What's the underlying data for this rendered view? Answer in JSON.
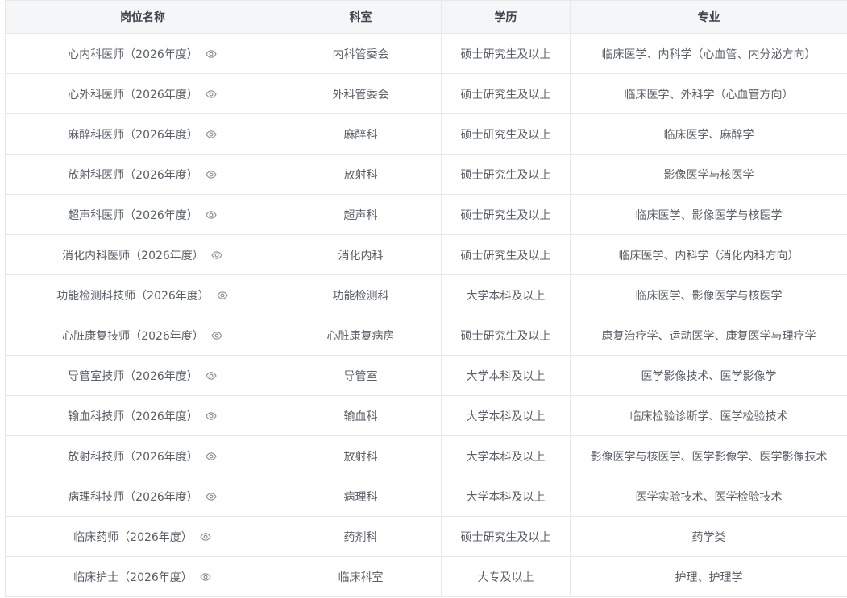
{
  "table": {
    "headers": [
      "岗位名称",
      "科室",
      "学历",
      "专业"
    ],
    "rows": [
      {
        "position": "心内科医师（2026年度）",
        "dept": "内科管委会",
        "edu": "硕士研究生及以上",
        "major": "临床医学、内科学（心血管、内分泌方向）"
      },
      {
        "position": "心外科医师（2026年度）",
        "dept": "外科管委会",
        "edu": "硕士研究生及以上",
        "major": "临床医学、外科学（心血管方向）"
      },
      {
        "position": "麻醉科医师（2026年度）",
        "dept": "麻醉科",
        "edu": "硕士研究生及以上",
        "major": "临床医学、麻醉学"
      },
      {
        "position": "放射科医师（2026年度）",
        "dept": "放射科",
        "edu": "硕士研究生及以上",
        "major": "影像医学与核医学"
      },
      {
        "position": "超声科医师（2026年度）",
        "dept": "超声科",
        "edu": "硕士研究生及以上",
        "major": "临床医学、影像医学与核医学"
      },
      {
        "position": "消化内科医师（2026年度）",
        "dept": "消化内科",
        "edu": "硕士研究生及以上",
        "major": "临床医学、内科学（消化内科方向）"
      },
      {
        "position": "功能检测科技师（2026年度）",
        "dept": "功能检测科",
        "edu": "大学本科及以上",
        "major": "临床医学、影像医学与核医学"
      },
      {
        "position": "心脏康复技师（2026年度）",
        "dept": "心脏康复病房",
        "edu": "硕士研究生及以上",
        "major": "康复治疗学、运动医学、康复医学与理疗学"
      },
      {
        "position": "导管室技师（2026年度）",
        "dept": "导管室",
        "edu": "大学本科及以上",
        "major": "医学影像技术、医学影像学"
      },
      {
        "position": "输血科技师（2026年度）",
        "dept": "输血科",
        "edu": "大学本科及以上",
        "major": "临床检验诊断学、医学检验技术"
      },
      {
        "position": "放射科技师（2026年度）",
        "dept": "放射科",
        "edu": "大学本科及以上",
        "major": "影像医学与核医学、医学影像学、医学影像技术"
      },
      {
        "position": "病理科技师（2026年度）",
        "dept": "病理科",
        "edu": "大学本科及以上",
        "major": "医学实验技术、医学检验技术"
      },
      {
        "position": "临床药师（2026年度）",
        "dept": "药剂科",
        "edu": "硕士研究生及以上",
        "major": "药学类"
      },
      {
        "position": "临床护士（2026年度）",
        "dept": "临床科室",
        "edu": "大专及以上",
        "major": "护理、护理学"
      }
    ]
  },
  "icons": {
    "view": "eye-icon"
  },
  "colors": {
    "header_bg": "#f5f6f8",
    "border": "#e6e8ec",
    "text": "#5a5f68",
    "icon": "#8a8f98"
  }
}
